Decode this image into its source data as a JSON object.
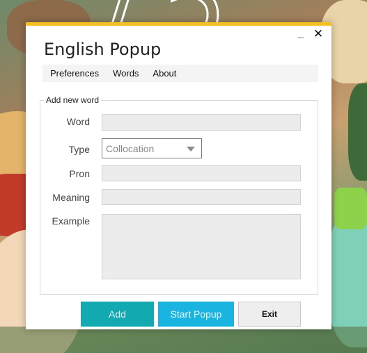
{
  "window": {
    "title": "English Popup",
    "minimize_glyph": "_",
    "close_glyph": "✕",
    "accent_color": "#f5c023"
  },
  "menu": {
    "items": [
      "Preferences",
      "Words",
      "About"
    ]
  },
  "form": {
    "group_label": "Add new word",
    "word": {
      "label": "Word",
      "value": ""
    },
    "type": {
      "label": "Type",
      "selected": "Collocation"
    },
    "pron": {
      "label": "Pron",
      "value": ""
    },
    "meaning": {
      "label": "Meaning",
      "value": ""
    },
    "example": {
      "label": "Example",
      "value": ""
    }
  },
  "buttons": {
    "add": {
      "label": "Add",
      "color": "#13a9b0"
    },
    "start_popup": {
      "label": "Start Popup",
      "color": "#19b4e0"
    },
    "exit": {
      "label": "Exit"
    }
  },
  "icons": {
    "dropdown": "chevron-down-icon",
    "close": "close-icon",
    "minimize": "minimize-icon"
  }
}
